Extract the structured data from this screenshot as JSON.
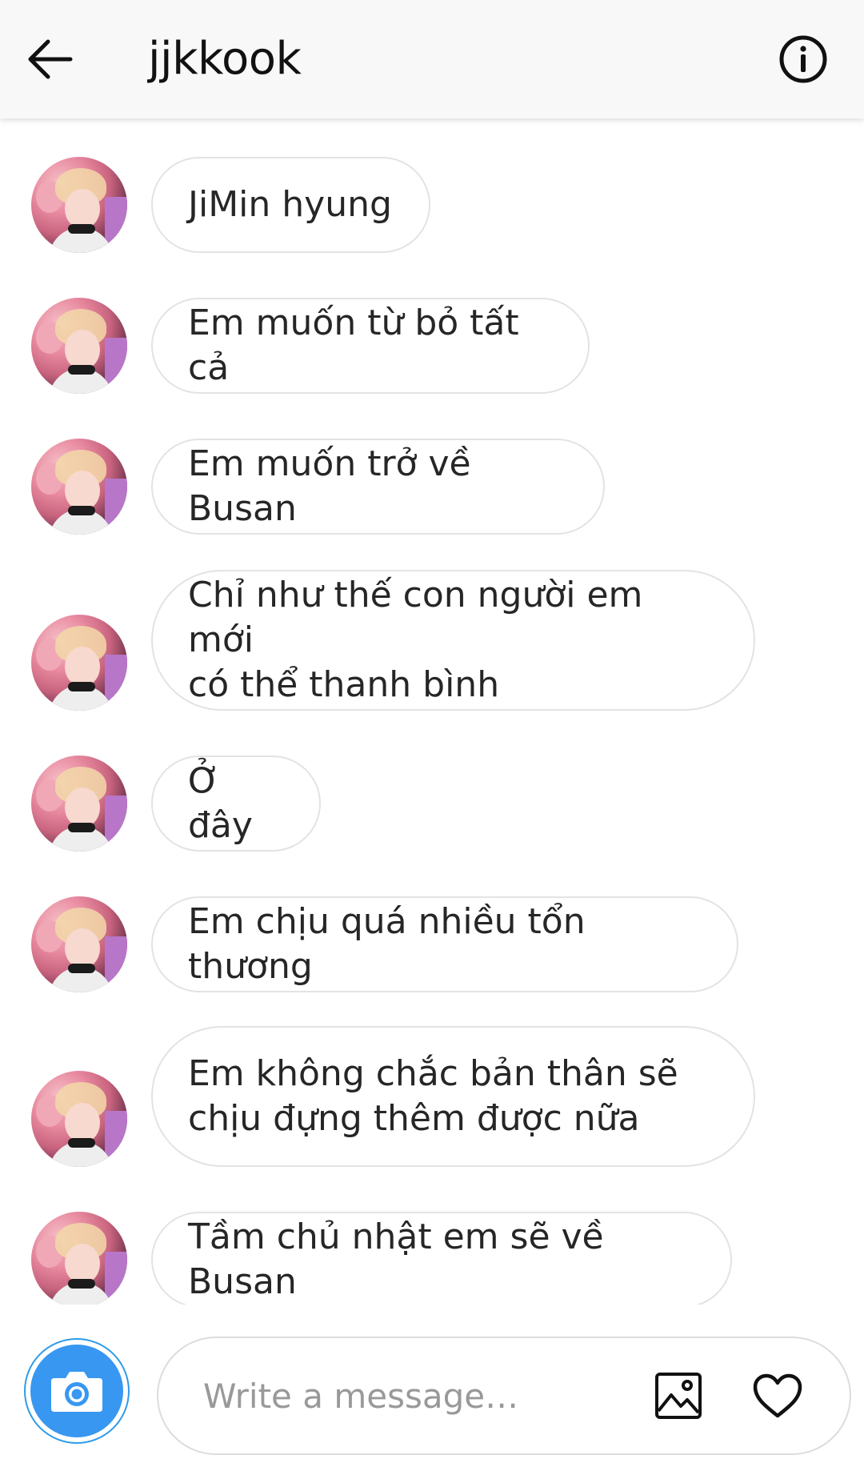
{
  "header": {
    "title": "jjkkook",
    "back_icon": "arrow-left-icon",
    "info_icon": "info-circle-icon"
  },
  "messages": [
    {
      "text": "JiMin hyung"
    },
    {
      "text": "Em muốn từ bỏ tất cả"
    },
    {
      "text": "Em muốn trở về Busan"
    },
    {
      "text": "Chỉ như thế con người em mới\ncó thể thanh bình"
    },
    {
      "text": "Ở đây"
    },
    {
      "text": "Em chịu quá nhiều tổn thương"
    },
    {
      "text": "Em không chắc bản thân sẽ\nchịu đựng thêm được nữa"
    },
    {
      "text": "Tầm chủ nhật em sẽ về Busan"
    }
  ],
  "composer": {
    "placeholder": "Write a message…",
    "camera_icon": "camera-icon",
    "gallery_icon": "gallery-icon",
    "like_icon": "heart-icon"
  },
  "colors": {
    "accent": "#3897f0",
    "bubble_border": "#e3e3e3",
    "text": "#262626",
    "placeholder": "#999999"
  }
}
